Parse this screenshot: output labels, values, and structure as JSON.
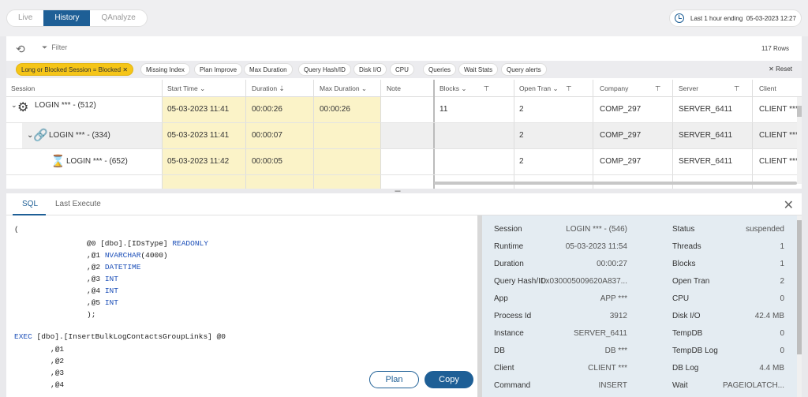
{
  "mode_tabs": [
    "Live",
    "History",
    "QAnalyze"
  ],
  "active_tab": "History",
  "time_range": {
    "label": "Last 1 hour ending",
    "value": "05-03-2023 12:27"
  },
  "toolbar": {
    "filter_label": "Filter",
    "row_count": "117 Rows"
  },
  "filter_chips": [
    {
      "label": "Long or Blocked Session = Blocked",
      "active": true
    },
    {
      "label": "Missing Index"
    },
    {
      "label": "Plan Improve"
    },
    {
      "label": "Max Duration"
    },
    {
      "label": "Query Hash/ID"
    },
    {
      "label": "Disk I/O"
    },
    {
      "label": "CPU"
    },
    {
      "label": "Queries"
    },
    {
      "label": "Wait Stats"
    },
    {
      "label": "Query alerts"
    }
  ],
  "reset_label": "Reset",
  "columns": [
    "Session",
    "Start Time",
    "Duration",
    "Max Duration",
    "Note",
    "Blocks",
    "Open Tran",
    "Company",
    "Server",
    "Client"
  ],
  "rows": [
    {
      "session": "LOGIN *** - (512)",
      "start": "05-03-2023 11:41",
      "duration": "00:00:26",
      "max_duration": "00:00:26",
      "blocks": "11",
      "open_tran": "2",
      "company": "COMP_297",
      "server": "SERVER_6411",
      "client": "CLIENT ***"
    },
    {
      "session": "LOGIN *** - (334)",
      "start": "05-03-2023 11:41",
      "duration": "00:00:07",
      "max_duration": "",
      "blocks": "",
      "open_tran": "2",
      "company": "COMP_297",
      "server": "SERVER_6411",
      "client": "CLIENT ***"
    },
    {
      "session": "LOGIN *** - (652)",
      "start": "05-03-2023 11:42",
      "duration": "00:00:05",
      "max_duration": "",
      "blocks": "",
      "open_tran": "2",
      "company": "COMP_297",
      "server": "SERVER_6411",
      "client": "CLIENT ***"
    }
  ],
  "bottom_tabs": [
    "SQL",
    "Last Execute"
  ],
  "sql_lines": [
    {
      "text": "(",
      "indent": 0
    },
    {
      "text": "@0 [dbo].[IDsType] READONLY",
      "indent": 2
    },
    {
      "text": ",@1 NVARCHAR(4000)",
      "indent": 2
    },
    {
      "text": ",@2 DATETIME",
      "indent": 2
    },
    {
      "text": ",@3 INT",
      "indent": 2
    },
    {
      "text": ",@4 INT",
      "indent": 2
    },
    {
      "text": ",@5 INT",
      "indent": 2
    },
    {
      "text": ");",
      "indent": 2
    },
    {
      "text": "",
      "indent": 0
    },
    {
      "text": "EXEC [dbo].[InsertBulkLogContactsGroupLinks] @0",
      "indent": 0
    },
    {
      "text": ",@1",
      "indent": 1
    },
    {
      "text": ",@2",
      "indent": 1
    },
    {
      "text": ",@3",
      "indent": 1
    },
    {
      "text": ",@4",
      "indent": 1
    }
  ],
  "buttons": {
    "plan": "Plan",
    "copy": "Copy"
  },
  "details_left": [
    {
      "label": "Session",
      "value": "LOGIN *** - (546)"
    },
    {
      "label": "Runtime",
      "value": "05-03-2023 11:54"
    },
    {
      "label": "Duration",
      "value": "00:00:27"
    },
    {
      "label": "Query Hash/ID",
      "value": "0x030005009620A837..."
    },
    {
      "label": "App",
      "value": "APP ***"
    },
    {
      "label": "Process Id",
      "value": "3912"
    },
    {
      "label": "Instance",
      "value": "SERVER_6411"
    },
    {
      "label": "DB",
      "value": "DB ***"
    },
    {
      "label": "Client",
      "value": "CLIENT ***"
    },
    {
      "label": "Command",
      "value": "INSERT"
    }
  ],
  "details_right": [
    {
      "label": "Status",
      "value": "suspended"
    },
    {
      "label": "Threads",
      "value": "1"
    },
    {
      "label": "Blocks",
      "value": "1"
    },
    {
      "label": "Open Tran",
      "value": "2"
    },
    {
      "label": "CPU",
      "value": "0"
    },
    {
      "label": "Disk I/O",
      "value": "42.4 MB"
    },
    {
      "label": "TempDB",
      "value": "0"
    },
    {
      "label": "TempDB Log",
      "value": "0"
    },
    {
      "label": "DB Log",
      "value": "4.4 MB"
    },
    {
      "label": "Wait",
      "value": "PAGEIOLATCH..."
    }
  ],
  "colors": {
    "accent": "#1e5f96",
    "chip_active": "#f5c518",
    "highlight": "#fbf3c8"
  }
}
